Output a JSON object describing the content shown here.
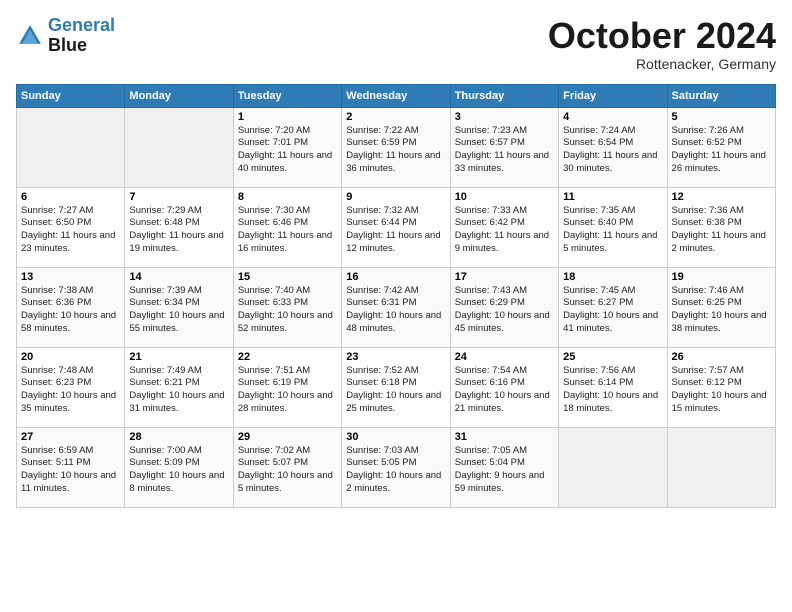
{
  "header": {
    "logo_line1": "General",
    "logo_line2": "Blue",
    "month": "October 2024",
    "location": "Rottenacker, Germany"
  },
  "weekdays": [
    "Sunday",
    "Monday",
    "Tuesday",
    "Wednesday",
    "Thursday",
    "Friday",
    "Saturday"
  ],
  "weeks": [
    [
      {
        "day": "",
        "info": ""
      },
      {
        "day": "",
        "info": ""
      },
      {
        "day": "1",
        "info": "Sunrise: 7:20 AM\nSunset: 7:01 PM\nDaylight: 11 hours and 40 minutes."
      },
      {
        "day": "2",
        "info": "Sunrise: 7:22 AM\nSunset: 6:59 PM\nDaylight: 11 hours and 36 minutes."
      },
      {
        "day": "3",
        "info": "Sunrise: 7:23 AM\nSunset: 6:57 PM\nDaylight: 11 hours and 33 minutes."
      },
      {
        "day": "4",
        "info": "Sunrise: 7:24 AM\nSunset: 6:54 PM\nDaylight: 11 hours and 30 minutes."
      },
      {
        "day": "5",
        "info": "Sunrise: 7:26 AM\nSunset: 6:52 PM\nDaylight: 11 hours and 26 minutes."
      }
    ],
    [
      {
        "day": "6",
        "info": "Sunrise: 7:27 AM\nSunset: 6:50 PM\nDaylight: 11 hours and 23 minutes."
      },
      {
        "day": "7",
        "info": "Sunrise: 7:29 AM\nSunset: 6:48 PM\nDaylight: 11 hours and 19 minutes."
      },
      {
        "day": "8",
        "info": "Sunrise: 7:30 AM\nSunset: 6:46 PM\nDaylight: 11 hours and 16 minutes."
      },
      {
        "day": "9",
        "info": "Sunrise: 7:32 AM\nSunset: 6:44 PM\nDaylight: 11 hours and 12 minutes."
      },
      {
        "day": "10",
        "info": "Sunrise: 7:33 AM\nSunset: 6:42 PM\nDaylight: 11 hours and 9 minutes."
      },
      {
        "day": "11",
        "info": "Sunrise: 7:35 AM\nSunset: 6:40 PM\nDaylight: 11 hours and 5 minutes."
      },
      {
        "day": "12",
        "info": "Sunrise: 7:36 AM\nSunset: 6:38 PM\nDaylight: 11 hours and 2 minutes."
      }
    ],
    [
      {
        "day": "13",
        "info": "Sunrise: 7:38 AM\nSunset: 6:36 PM\nDaylight: 10 hours and 58 minutes."
      },
      {
        "day": "14",
        "info": "Sunrise: 7:39 AM\nSunset: 6:34 PM\nDaylight: 10 hours and 55 minutes."
      },
      {
        "day": "15",
        "info": "Sunrise: 7:40 AM\nSunset: 6:33 PM\nDaylight: 10 hours and 52 minutes."
      },
      {
        "day": "16",
        "info": "Sunrise: 7:42 AM\nSunset: 6:31 PM\nDaylight: 10 hours and 48 minutes."
      },
      {
        "day": "17",
        "info": "Sunrise: 7:43 AM\nSunset: 6:29 PM\nDaylight: 10 hours and 45 minutes."
      },
      {
        "day": "18",
        "info": "Sunrise: 7:45 AM\nSunset: 6:27 PM\nDaylight: 10 hours and 41 minutes."
      },
      {
        "day": "19",
        "info": "Sunrise: 7:46 AM\nSunset: 6:25 PM\nDaylight: 10 hours and 38 minutes."
      }
    ],
    [
      {
        "day": "20",
        "info": "Sunrise: 7:48 AM\nSunset: 6:23 PM\nDaylight: 10 hours and 35 minutes."
      },
      {
        "day": "21",
        "info": "Sunrise: 7:49 AM\nSunset: 6:21 PM\nDaylight: 10 hours and 31 minutes."
      },
      {
        "day": "22",
        "info": "Sunrise: 7:51 AM\nSunset: 6:19 PM\nDaylight: 10 hours and 28 minutes."
      },
      {
        "day": "23",
        "info": "Sunrise: 7:52 AM\nSunset: 6:18 PM\nDaylight: 10 hours and 25 minutes."
      },
      {
        "day": "24",
        "info": "Sunrise: 7:54 AM\nSunset: 6:16 PM\nDaylight: 10 hours and 21 minutes."
      },
      {
        "day": "25",
        "info": "Sunrise: 7:56 AM\nSunset: 6:14 PM\nDaylight: 10 hours and 18 minutes."
      },
      {
        "day": "26",
        "info": "Sunrise: 7:57 AM\nSunset: 6:12 PM\nDaylight: 10 hours and 15 minutes."
      }
    ],
    [
      {
        "day": "27",
        "info": "Sunrise: 6:59 AM\nSunset: 5:11 PM\nDaylight: 10 hours and 11 minutes."
      },
      {
        "day": "28",
        "info": "Sunrise: 7:00 AM\nSunset: 5:09 PM\nDaylight: 10 hours and 8 minutes."
      },
      {
        "day": "29",
        "info": "Sunrise: 7:02 AM\nSunset: 5:07 PM\nDaylight: 10 hours and 5 minutes."
      },
      {
        "day": "30",
        "info": "Sunrise: 7:03 AM\nSunset: 5:05 PM\nDaylight: 10 hours and 2 minutes."
      },
      {
        "day": "31",
        "info": "Sunrise: 7:05 AM\nSunset: 5:04 PM\nDaylight: 9 hours and 59 minutes."
      },
      {
        "day": "",
        "info": ""
      },
      {
        "day": "",
        "info": ""
      }
    ]
  ]
}
